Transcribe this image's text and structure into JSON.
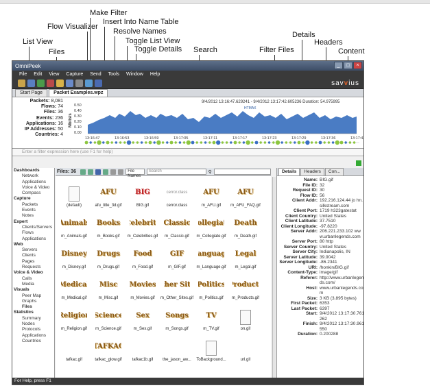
{
  "callouts": {
    "make_filter": "Make Filter",
    "flow_visualizer": "Flow Visualizer",
    "insert_name_table": "Insert Into Name Table",
    "resolve_names": "Resolve Names",
    "toggle_list_view": "Toggle List View",
    "toggle_details": "Toggle Details",
    "list_view": "List View",
    "files": "Files",
    "search": "Search",
    "filter_files": "Filter Files",
    "details": "Details",
    "headers": "Headers",
    "content": "Content"
  },
  "window": {
    "title": "OmniPeek",
    "brand_prefix": "sav",
    "brand_accent": "v",
    "brand_suffix": "ius"
  },
  "menu": [
    "File",
    "Edit",
    "View",
    "Capture",
    "Send",
    "Tools",
    "Window",
    "Help"
  ],
  "tabs": {
    "start": "Start Page",
    "active": "Packet Examples.wpz"
  },
  "stats": [
    {
      "label": "Packets:",
      "value": "8,081"
    },
    {
      "label": "Flows:",
      "value": "74"
    },
    {
      "label": "Files:",
      "value": "36"
    },
    {
      "label": "Events:",
      "value": "236"
    },
    {
      "label": "Applications:",
      "value": "16"
    },
    {
      "label": "IP Addresses:",
      "value": "50"
    },
    {
      "label": "Countries:",
      "value": "4"
    }
  ],
  "graph": {
    "header": "9/4/2012 13:16:47.629241 - 9/4/2012 13:17:42.605236 Duration: 54.975995",
    "ylabel": "Mbits/s",
    "yticks": [
      "0.50",
      "0.40",
      "0.30",
      "0.20",
      "0.10",
      "0.00"
    ],
    "xticks": [
      "13:16:47",
      "13:16:53",
      "13:16:59",
      "13:17:05",
      "13:17:11",
      "13:17:17",
      "13:17:23",
      "13:17:29",
      "13:17:36",
      "13:17:42"
    ],
    "annotation": "HTMAX",
    "colors": {
      "area": "#4a7cc4",
      "dot_a": "#8dc63f",
      "dot_b": "#3a6fc4"
    }
  },
  "filter_placeholder": "Enter a filter expression here (use F1 for help)",
  "files_toolbar": {
    "count_label": "Files: 36",
    "search_scope": "File Names",
    "search_placeholder": "Search"
  },
  "dashboard": [
    {
      "section": "Dashboards",
      "items": [
        "Network",
        "Applications",
        "Voice & Video",
        "Compass"
      ]
    },
    {
      "section": "Capture",
      "items": [
        "Packets",
        "Events",
        "Notes"
      ]
    },
    {
      "section": "Expert",
      "items": [
        "Clients/Servers",
        "Flows",
        "Applications"
      ]
    },
    {
      "section": "Web",
      "items": [
        "Servers",
        "Clients",
        "Pages",
        "Requests"
      ]
    },
    {
      "section": "Voice & Video",
      "items": [
        "Calls",
        "Media"
      ]
    },
    {
      "section": "Visuals",
      "items": [
        "Peer Map",
        "Graphs",
        "Files"
      ]
    },
    {
      "section": "Statistics",
      "items": [
        "Summary",
        "Nodes",
        "Protocols",
        "Applications",
        "Countries"
      ]
    }
  ],
  "files": [
    {
      "name": "(default)",
      "art": "",
      "style": "doc"
    },
    {
      "name": "afu_title_3d.gif",
      "art": "AFU",
      "style": "gold"
    },
    {
      "name": "BIG.gif",
      "art": "BIG",
      "style": "red"
    },
    {
      "name": "cerror.class",
      "art": "cerror.class",
      "style": "gray"
    },
    {
      "name": "m_AFU.gif",
      "art": "AFU",
      "style": "gold"
    },
    {
      "name": "m_AFU_FAQ.gif",
      "art": "AFU",
      "style": "gold"
    },
    {
      "name": "m_Animals.gif",
      "art": "Animals",
      "style": "gold"
    },
    {
      "name": "m_Books.gif",
      "art": "Books",
      "style": "gold"
    },
    {
      "name": "m_Celebrities.gif",
      "art": "Celebrity",
      "style": "gold"
    },
    {
      "name": "m_Classic.gif",
      "art": "Classic",
      "style": "gold"
    },
    {
      "name": "m_Collegiate.gif",
      "art": "Collegiate",
      "style": "gold"
    },
    {
      "name": "m_Death.gif",
      "art": "Death",
      "style": "gold"
    },
    {
      "name": "m_Disney.gif",
      "art": "Disney",
      "style": "gold"
    },
    {
      "name": "m_Drugs.gif",
      "art": "Drugs",
      "style": "gold"
    },
    {
      "name": "m_Food.gif",
      "art": "Food",
      "style": "gold"
    },
    {
      "name": "m_GIF.gif",
      "art": "GIF",
      "style": "gold"
    },
    {
      "name": "m_Language.gif",
      "art": "Language",
      "style": "gold"
    },
    {
      "name": "m_Legal.gif",
      "art": "Legal",
      "style": "gold"
    },
    {
      "name": "m_Medical.gif",
      "art": "Medical",
      "style": "gold"
    },
    {
      "name": "m_Misc.gif",
      "art": "Misc",
      "style": "gold"
    },
    {
      "name": "m_Movies.gif",
      "art": "Movies",
      "style": "gold"
    },
    {
      "name": "m_Other_Sites.gif",
      "art": "Other Sites",
      "style": "gold"
    },
    {
      "name": "m_Politics.gif",
      "art": "Politics",
      "style": "gold"
    },
    {
      "name": "m_Products.gif",
      "art": "Products",
      "style": "gold"
    },
    {
      "name": "m_Religion.gif",
      "art": "Religion",
      "style": "gold"
    },
    {
      "name": "m_Science.gif",
      "art": "Science",
      "style": "gold"
    },
    {
      "name": "m_Sex.gif",
      "art": "Sex",
      "style": "gold"
    },
    {
      "name": "m_Songs.gif",
      "art": "Songs",
      "style": "gold"
    },
    {
      "name": "m_TV.gif",
      "art": "TV",
      "style": "gold"
    },
    {
      "name": "on.gif",
      "art": "",
      "style": "doc"
    },
    {
      "name": "tafkac.gif",
      "art": "",
      "style": "red"
    },
    {
      "name": "tafkac_glow.gif",
      "art": "TAFKAC",
      "style": "gold"
    },
    {
      "name": "tafkac1b.gif",
      "art": "",
      "style": "gold"
    },
    {
      "name": "the_jason_aw...",
      "art": "",
      "style": "red"
    },
    {
      "name": "ToBackground...",
      "art": "",
      "style": "doc"
    },
    {
      "name": "url.gif",
      "art": "",
      "style": "gold"
    }
  ],
  "details_tabs": [
    "Details",
    "Headers",
    "Con..."
  ],
  "details": [
    {
      "k": "Name:",
      "v": "BIG.gif"
    },
    {
      "k": "File ID:",
      "v": "32"
    },
    {
      "k": "Request ID:",
      "v": "30"
    },
    {
      "k": "Flow ID:",
      "v": "56"
    },
    {
      "k": "Client Addr:",
      "v": "192.216.124.44 jo hn.silkstream.com"
    },
    {
      "k": "Client Port:",
      "v": "1719 h323gatestat"
    },
    {
      "k": "Client Country:",
      "v": "United States"
    },
    {
      "k": "Client Latitude:",
      "v": "37.7510"
    },
    {
      "k": "Client Longitude:",
      "v": "-97.8220"
    },
    {
      "k": "Server Addr:",
      "v": "206.221.233.102 www.urbanlegends.com"
    },
    {
      "k": "Server Port:",
      "v": "80 http"
    },
    {
      "k": "Server Country:",
      "v": "United States"
    },
    {
      "k": "Server City:",
      "v": "Indianapolis, IN"
    },
    {
      "k": "Server Latitude:",
      "v": "39.9042"
    },
    {
      "k": "Server Longitude:",
      "v": "-86.2341"
    },
    {
      "k": "URI:",
      "v": "/honkin/BIG.gif"
    },
    {
      "k": "Content-Type:",
      "v": "image/gif"
    },
    {
      "k": "Referer:",
      "v": "http://www.urbanlegends.com/"
    },
    {
      "k": "Host:",
      "v": "www.urbanlegends.com"
    },
    {
      "k": "Size:",
      "v": "3 KB (3,895 bytes)"
    },
    {
      "k": "First Packet:",
      "v": "6353"
    },
    {
      "k": "Last Packet:",
      "v": "6397"
    },
    {
      "k": "Start:",
      "v": "9/4/2012 13:17:30.761262"
    },
    {
      "k": "Finish:",
      "v": "9/4/2012 13:17:30.961550"
    },
    {
      "k": "Duration:",
      "v": "0.200288"
    }
  ],
  "status": "For Help, press F1"
}
